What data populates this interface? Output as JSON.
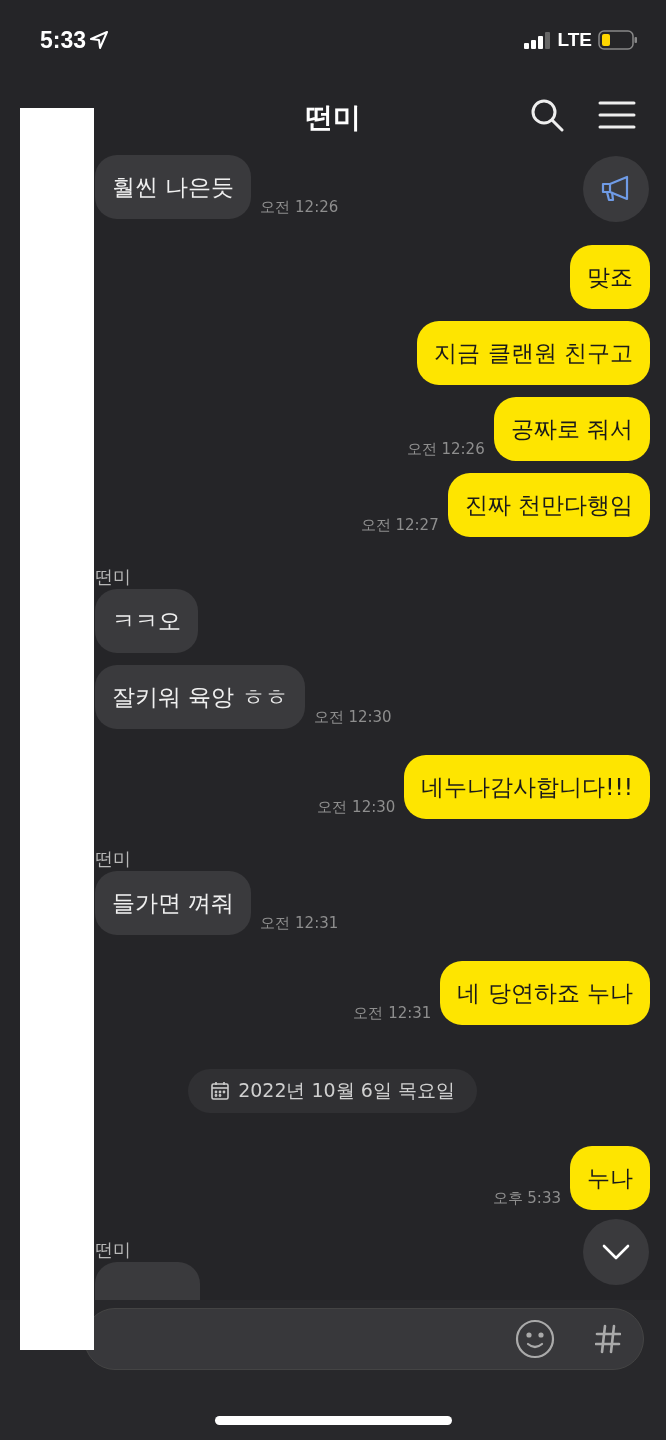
{
  "status_bar": {
    "time": "5:33",
    "network": "LTE"
  },
  "header": {
    "title": "떤미"
  },
  "messages": [
    {
      "kind": "received",
      "text": "훨씬 나은듯",
      "time": "오전 12:26"
    },
    {
      "kind": "sent",
      "text": "맞죠"
    },
    {
      "kind": "sent",
      "text": "지금 클랜원 친구고"
    },
    {
      "kind": "sent",
      "text": "공짜로 줘서",
      "time": "오전 12:26"
    },
    {
      "kind": "sent",
      "text": "진짜 천만다행임",
      "time": "오전 12:27"
    },
    {
      "kind": "received",
      "sender": "떤미",
      "text": "ㅋㅋ오"
    },
    {
      "kind": "received",
      "text": "잘키워 육앙 ㅎㅎ",
      "time": "오전 12:30"
    },
    {
      "kind": "sent",
      "text": "네누나감사합니다!!!",
      "time": "오전 12:30"
    },
    {
      "kind": "received",
      "sender": "떤미",
      "text": "들가면 껴줘",
      "time": "오전 12:31"
    },
    {
      "kind": "sent",
      "text": "네 당연하죠 누나",
      "time": "오전 12:31"
    },
    {
      "kind": "date",
      "text": "2022년 10월 6일 목요일"
    },
    {
      "kind": "sent",
      "text": "누나",
      "time": "오후 5:33"
    },
    {
      "kind": "received",
      "sender": "떤미"
    }
  ]
}
